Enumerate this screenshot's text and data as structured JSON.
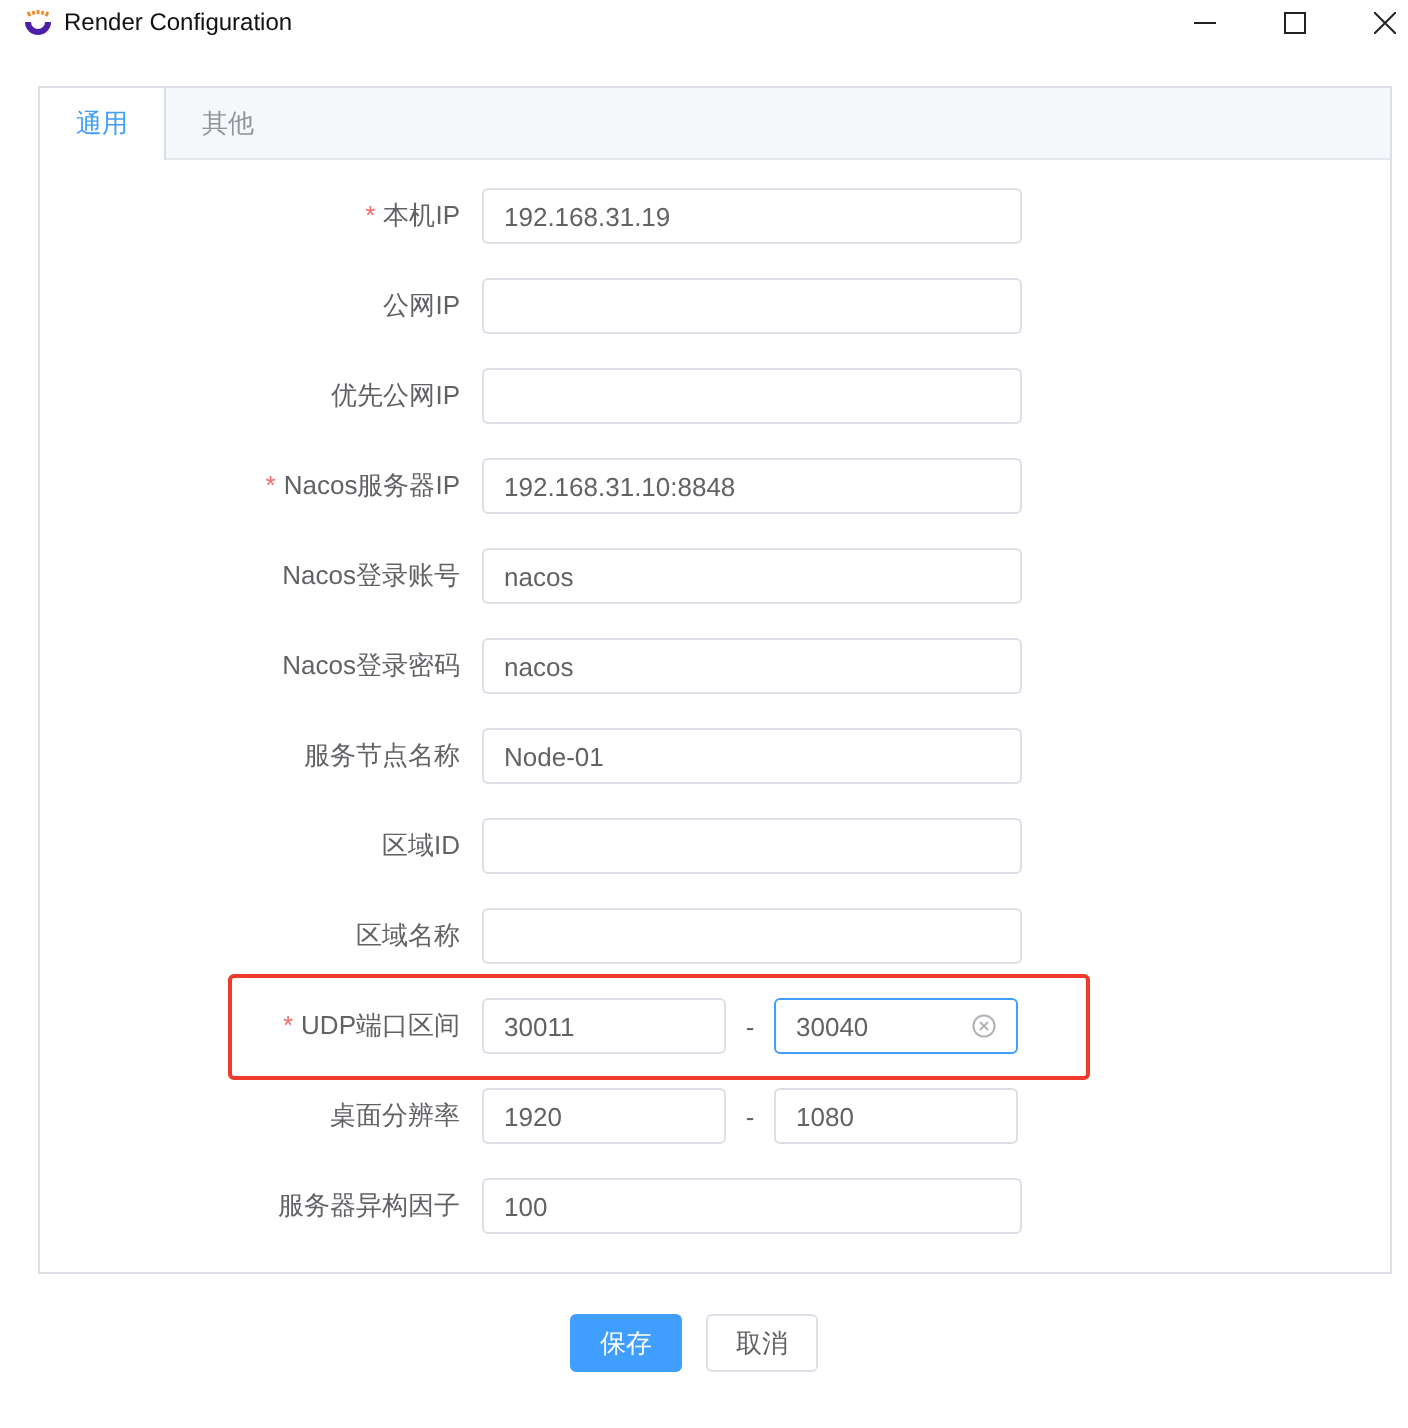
{
  "window": {
    "title": "Render Configuration"
  },
  "tabs": [
    {
      "label": "通用",
      "selected": true
    },
    {
      "label": "其他",
      "selected": false
    }
  ],
  "fields": [
    {
      "kind": "text",
      "required_mark": "*",
      "label": "本机IP",
      "value": "192.168.31.19"
    },
    {
      "kind": "text",
      "label": "公网IP"
    },
    {
      "kind": "text",
      "label": "优先公网IP"
    },
    {
      "kind": "text",
      "required_mark": "*",
      "label": "Nacos服务器IP",
      "value": "192.168.31.10:8848"
    },
    {
      "kind": "text",
      "label": "Nacos登录账号",
      "value": "nacos"
    },
    {
      "kind": "text",
      "label": "Nacos登录密码",
      "value": "nacos"
    },
    {
      "kind": "text",
      "label": "服务节点名称",
      "value": "Node-01"
    },
    {
      "kind": "text",
      "label": "区域ID"
    },
    {
      "kind": "text",
      "label": "区域名称"
    },
    {
      "kind": "range",
      "required_mark": "*",
      "label": "UDP端口区间",
      "highlighted": true,
      "separator": "-",
      "inputs": [
        {
          "value": "30011",
          "focused": false
        },
        {
          "value": "30040",
          "focused": true
        }
      ]
    },
    {
      "kind": "range",
      "label": "桌面分辨率",
      "highlighted": false,
      "separator": "-",
      "inputs": [
        {
          "value": "1920",
          "focused": false
        },
        {
          "value": "1080",
          "focused": false
        }
      ]
    },
    {
      "kind": "text",
      "label": "服务器异构因子",
      "value": "100"
    }
  ],
  "buttons": [
    {
      "label": "保存",
      "kind": "primary"
    },
    {
      "label": "取消",
      "kind": "default"
    }
  ]
}
